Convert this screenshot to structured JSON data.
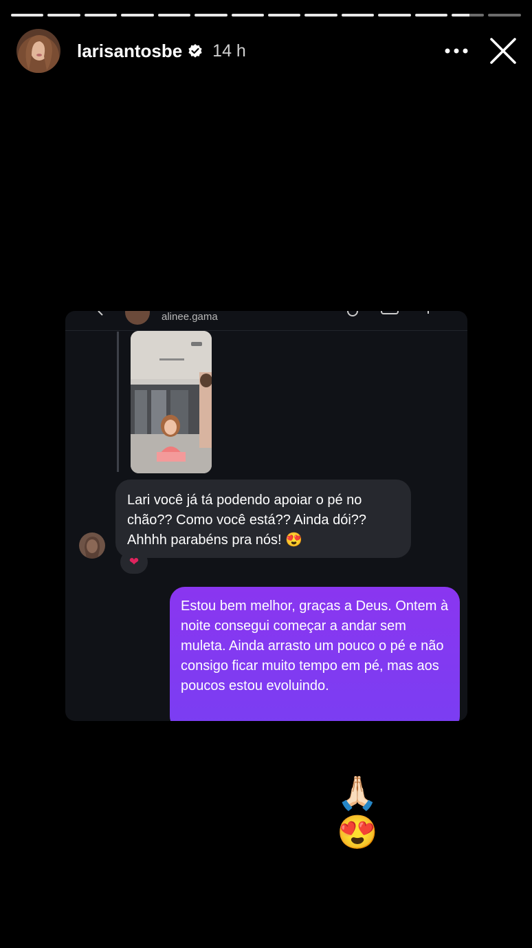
{
  "story": {
    "progress": {
      "segments_total": 14,
      "current_index": 12,
      "current_fraction": 0.55
    },
    "author": {
      "username": "larisantosbe",
      "verified": true,
      "posted_ago": "14 h"
    },
    "actions": {
      "more_icon": "more-dots-icon",
      "close_icon": "close-icon"
    },
    "dm": {
      "username": "alinee.gama",
      "incoming_message": "Lari você já tá podendo apoiar o pé no chão?? Como você está?? Ainda dói?? Ahhhh parabéns pra nós! 😍",
      "reaction": "❤",
      "outgoing_message": "Estou bem melhor, graças a Deus. Ontem à noite consegui começar a andar sem muleta. Ainda arrasto um pouco o pé e não consigo ficar muito tempo em pé, mas aos poucos estou evoluindo."
    },
    "sticker": "🙏🏻😍"
  },
  "colors": {
    "background": "#000000",
    "card": "#101217",
    "incoming_bubble": "#26282e",
    "outgoing_bubble": "#8a36f0",
    "reaction": "#e0245e"
  }
}
